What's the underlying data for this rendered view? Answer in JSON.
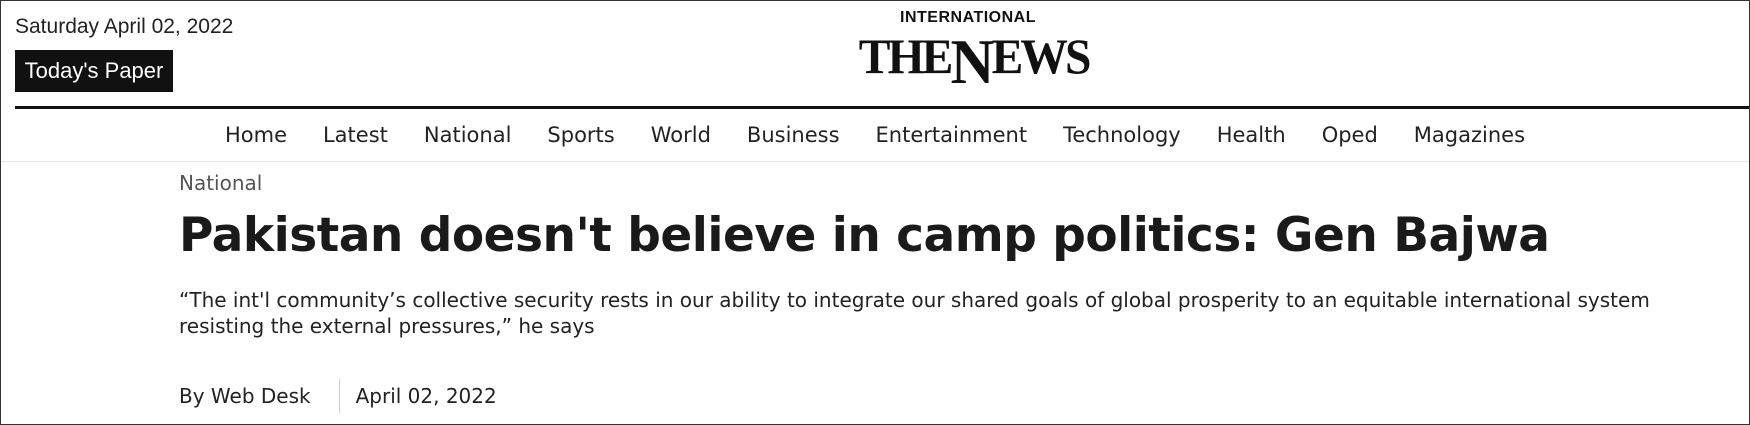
{
  "header": {
    "date": "Saturday April 02, 2022",
    "todays_paper_label": "Today's Paper",
    "logo": {
      "top": "INTERNATIONAL",
      "main_prefix": "THE",
      "main_n": "N",
      "main_suffix": "EWS"
    }
  },
  "nav": {
    "items": [
      "Home",
      "Latest",
      "National",
      "Sports",
      "World",
      "Business",
      "Entertainment",
      "Technology",
      "Health",
      "Oped",
      "Magazines"
    ]
  },
  "article": {
    "category": "National",
    "headline": "Pakistan doesn't believe in camp politics: Gen Bajwa",
    "summary": "“The int'l community’s collective security rests in our ability to integrate our shared goals of global prosperity to an equitable international system resisting the external pressures,” he says",
    "author": "By Web Desk",
    "date": "April 02, 2022"
  }
}
